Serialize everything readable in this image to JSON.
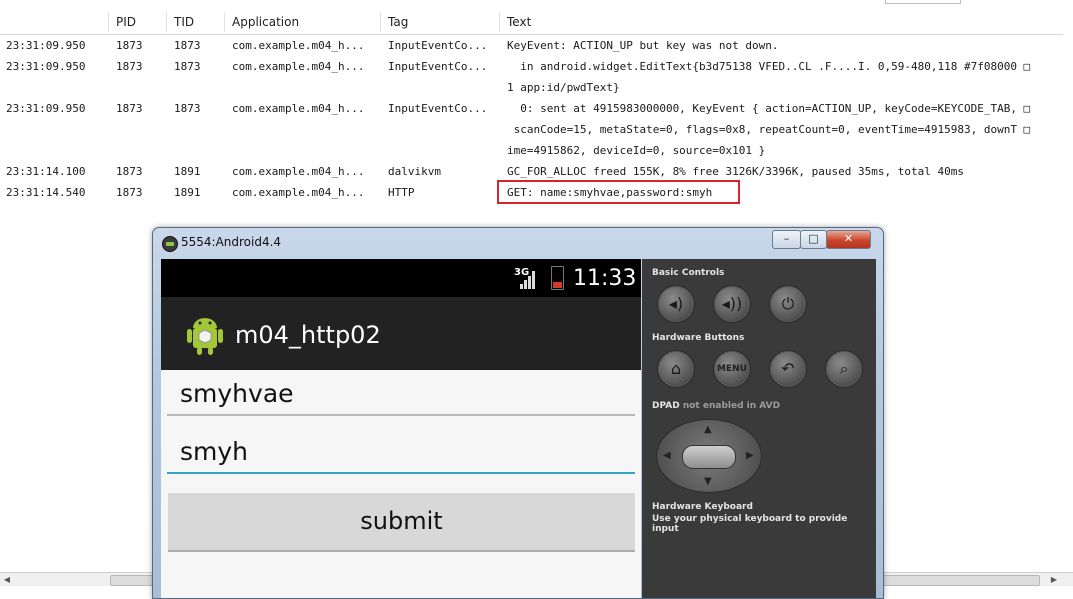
{
  "logcat": {
    "columns": [
      "",
      "PID",
      "TID",
      "Application",
      "Tag",
      "Text"
    ],
    "rows": [
      {
        "time": "23:31:09.950",
        "pid": "1873",
        "tid": "1873",
        "app": "com.example.m04_h...",
        "tag": "InputEventCo...",
        "text": "KeyEvent: ACTION_UP but key was not down."
      },
      {
        "time": "23:31:09.950",
        "pid": "1873",
        "tid": "1873",
        "app": "com.example.m04_h...",
        "tag": "InputEventCo...",
        "text": "  in android.widget.EditText{b3d75138 VFED..CL .F....I. 0,59-480,118 #7f08000 □"
      },
      {
        "time": "23:31:09.950",
        "pid": "1873",
        "tid": "1873",
        "app": "com.example.m04_h...",
        "tag": "InputEventCo...",
        "text": "  0: sent at 4915983000000, KeyEvent { action=ACTION_UP, keyCode=KEYCODE_TAB, □"
      },
      {
        "time": "23:31:14.100",
        "pid": "1873",
        "tid": "1891",
        "app": "com.example.m04_h...",
        "tag": "dalvikvm",
        "text": "GC_FOR_ALLOC freed 155K, 8% free 3126K/3396K, paused 35ms, total 40ms"
      },
      {
        "time": "23:31:14.540",
        "pid": "1873",
        "tid": "1891",
        "app": "com.example.m04_h...",
        "tag": "HTTP",
        "text": "GET: name:smyhvae,password:smyh"
      }
    ],
    "continuations": [
      "1 app:id/pwdText}",
      " scanCode=15, metaState=0, flags=0x8, repeatCount=0, eventTime=4915983, downT □",
      "ime=4915862, deviceId=0, source=0x101 }"
    ]
  },
  "emulator": {
    "window_title": "5554:Android4.4",
    "status": {
      "network": "3G",
      "clock": "11:33"
    },
    "app_title": "m04_http02",
    "username_value": "smyhvae",
    "password_value": "smyh",
    "submit_label": "submit",
    "controls": {
      "basic_controls": "Basic Controls",
      "hardware_buttons": "Hardware Buttons",
      "menu_label": "MENU",
      "dpad": "DPAD",
      "dpad_note": "not enabled in AVD",
      "keyboard_title": "Hardware Keyboard",
      "keyboard_note": "Use your physical keyboard to provide input"
    }
  },
  "colors": {
    "highlight": "#d9242b",
    "focus_underline": "#33a3c8",
    "actionbar": "#222222"
  }
}
